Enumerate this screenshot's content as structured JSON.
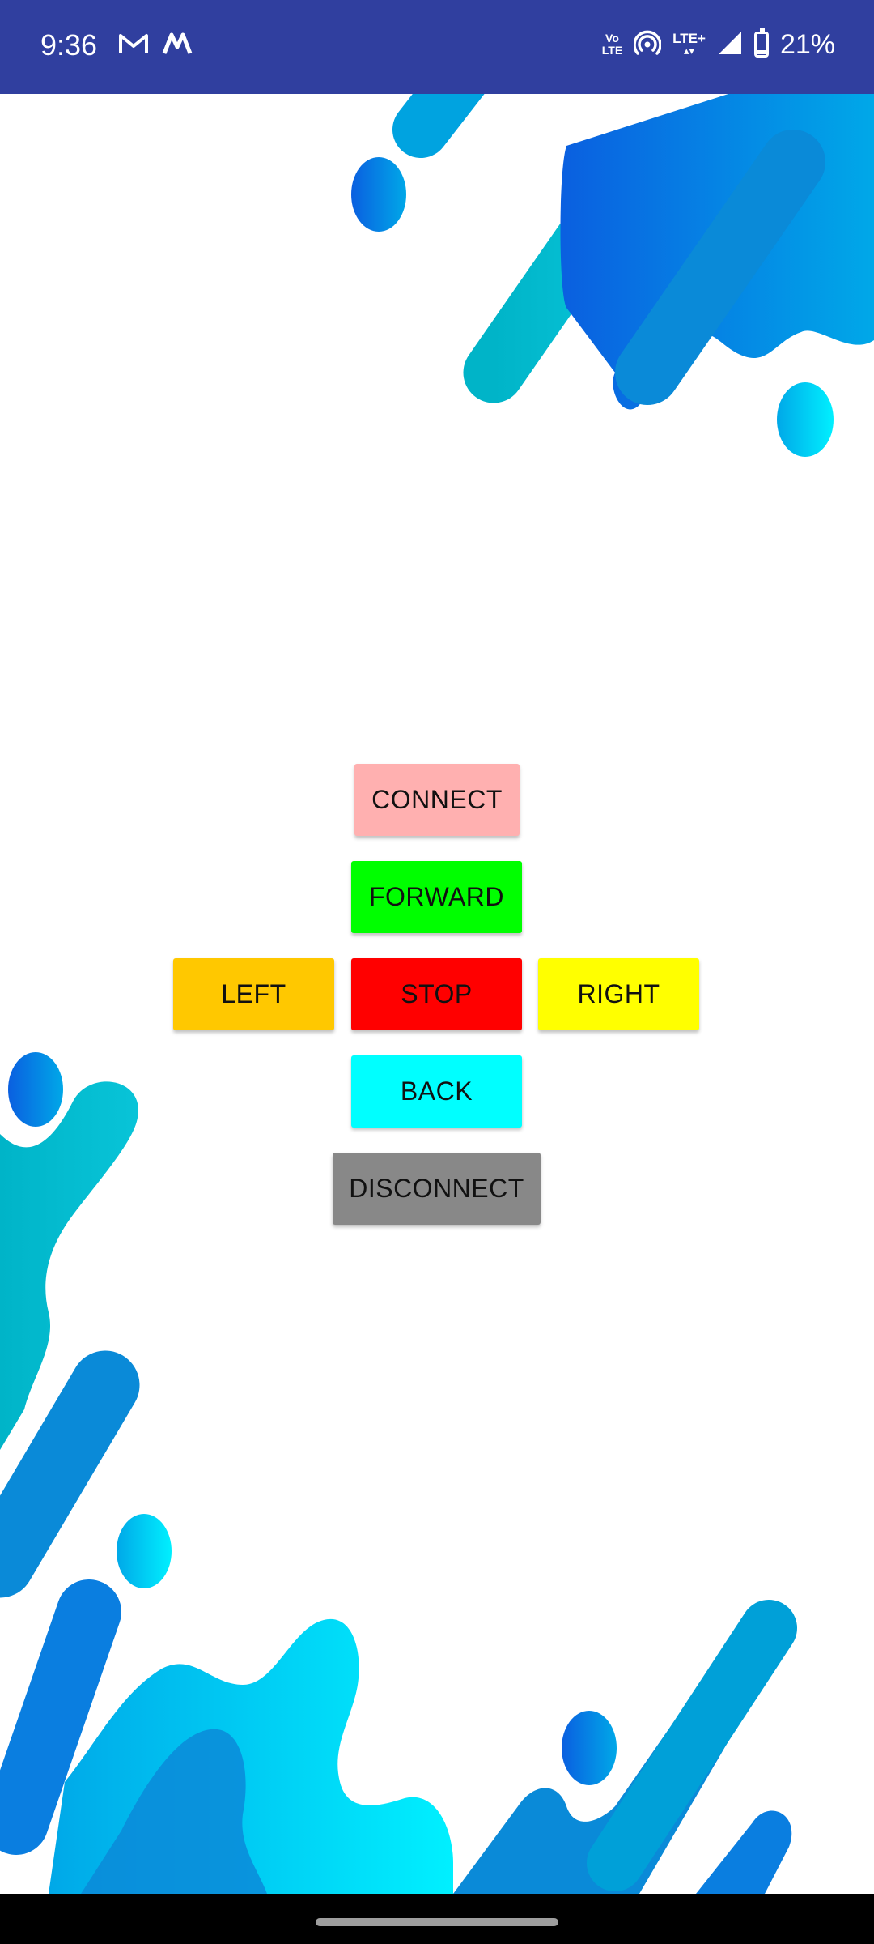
{
  "status_bar": {
    "time": "9:36",
    "left_icons": [
      "gmail-icon",
      "myntra-icon"
    ],
    "volte_line1": "Vo",
    "volte_line2": "LTE",
    "network_label": "LTE+",
    "battery": "21%",
    "battery_level": 0.21
  },
  "buttons": {
    "connect": "CONNECT",
    "forward": "FORWARD",
    "left": "LEFT",
    "stop": "STOP",
    "right": "RIGHT",
    "back": "BACK",
    "disconnect": "DISCONNECT"
  },
  "colors": {
    "status_bar": "#303F9F",
    "connect": "#FFB0B0",
    "forward": "#00FF00",
    "left": "#FFC800",
    "stop": "#FF0000",
    "right": "#FFFF00",
    "back": "#00FFFF",
    "disconnect": "#888888",
    "splash_blue": "#0A74E0",
    "splash_cyan": "#00C4E8"
  }
}
